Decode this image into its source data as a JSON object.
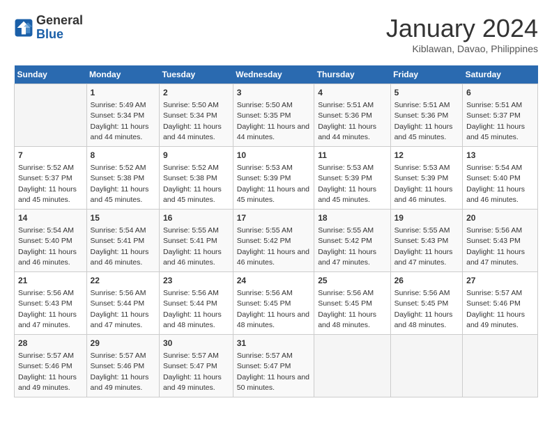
{
  "logo": {
    "text_general": "General",
    "text_blue": "Blue"
  },
  "header": {
    "title": "January 2024",
    "subtitle": "Kiblawan, Davao, Philippines"
  },
  "days_of_week": [
    "Sunday",
    "Monday",
    "Tuesday",
    "Wednesday",
    "Thursday",
    "Friday",
    "Saturday"
  ],
  "weeks": [
    [
      {
        "day": "",
        "sunrise": "",
        "sunset": "",
        "daylight": ""
      },
      {
        "day": "1",
        "sunrise": "Sunrise: 5:49 AM",
        "sunset": "Sunset: 5:34 PM",
        "daylight": "Daylight: 11 hours and 44 minutes."
      },
      {
        "day": "2",
        "sunrise": "Sunrise: 5:50 AM",
        "sunset": "Sunset: 5:34 PM",
        "daylight": "Daylight: 11 hours and 44 minutes."
      },
      {
        "day": "3",
        "sunrise": "Sunrise: 5:50 AM",
        "sunset": "Sunset: 5:35 PM",
        "daylight": "Daylight: 11 hours and 44 minutes."
      },
      {
        "day": "4",
        "sunrise": "Sunrise: 5:51 AM",
        "sunset": "Sunset: 5:36 PM",
        "daylight": "Daylight: 11 hours and 44 minutes."
      },
      {
        "day": "5",
        "sunrise": "Sunrise: 5:51 AM",
        "sunset": "Sunset: 5:36 PM",
        "daylight": "Daylight: 11 hours and 45 minutes."
      },
      {
        "day": "6",
        "sunrise": "Sunrise: 5:51 AM",
        "sunset": "Sunset: 5:37 PM",
        "daylight": "Daylight: 11 hours and 45 minutes."
      }
    ],
    [
      {
        "day": "7",
        "sunrise": "Sunrise: 5:52 AM",
        "sunset": "Sunset: 5:37 PM",
        "daylight": "Daylight: 11 hours and 45 minutes."
      },
      {
        "day": "8",
        "sunrise": "Sunrise: 5:52 AM",
        "sunset": "Sunset: 5:38 PM",
        "daylight": "Daylight: 11 hours and 45 minutes."
      },
      {
        "day": "9",
        "sunrise": "Sunrise: 5:52 AM",
        "sunset": "Sunset: 5:38 PM",
        "daylight": "Daylight: 11 hours and 45 minutes."
      },
      {
        "day": "10",
        "sunrise": "Sunrise: 5:53 AM",
        "sunset": "Sunset: 5:39 PM",
        "daylight": "Daylight: 11 hours and 45 minutes."
      },
      {
        "day": "11",
        "sunrise": "Sunrise: 5:53 AM",
        "sunset": "Sunset: 5:39 PM",
        "daylight": "Daylight: 11 hours and 45 minutes."
      },
      {
        "day": "12",
        "sunrise": "Sunrise: 5:53 AM",
        "sunset": "Sunset: 5:39 PM",
        "daylight": "Daylight: 11 hours and 46 minutes."
      },
      {
        "day": "13",
        "sunrise": "Sunrise: 5:54 AM",
        "sunset": "Sunset: 5:40 PM",
        "daylight": "Daylight: 11 hours and 46 minutes."
      }
    ],
    [
      {
        "day": "14",
        "sunrise": "Sunrise: 5:54 AM",
        "sunset": "Sunset: 5:40 PM",
        "daylight": "Daylight: 11 hours and 46 minutes."
      },
      {
        "day": "15",
        "sunrise": "Sunrise: 5:54 AM",
        "sunset": "Sunset: 5:41 PM",
        "daylight": "Daylight: 11 hours and 46 minutes."
      },
      {
        "day": "16",
        "sunrise": "Sunrise: 5:55 AM",
        "sunset": "Sunset: 5:41 PM",
        "daylight": "Daylight: 11 hours and 46 minutes."
      },
      {
        "day": "17",
        "sunrise": "Sunrise: 5:55 AM",
        "sunset": "Sunset: 5:42 PM",
        "daylight": "Daylight: 11 hours and 46 minutes."
      },
      {
        "day": "18",
        "sunrise": "Sunrise: 5:55 AM",
        "sunset": "Sunset: 5:42 PM",
        "daylight": "Daylight: 11 hours and 47 minutes."
      },
      {
        "day": "19",
        "sunrise": "Sunrise: 5:55 AM",
        "sunset": "Sunset: 5:43 PM",
        "daylight": "Daylight: 11 hours and 47 minutes."
      },
      {
        "day": "20",
        "sunrise": "Sunrise: 5:56 AM",
        "sunset": "Sunset: 5:43 PM",
        "daylight": "Daylight: 11 hours and 47 minutes."
      }
    ],
    [
      {
        "day": "21",
        "sunrise": "Sunrise: 5:56 AM",
        "sunset": "Sunset: 5:43 PM",
        "daylight": "Daylight: 11 hours and 47 minutes."
      },
      {
        "day": "22",
        "sunrise": "Sunrise: 5:56 AM",
        "sunset": "Sunset: 5:44 PM",
        "daylight": "Daylight: 11 hours and 47 minutes."
      },
      {
        "day": "23",
        "sunrise": "Sunrise: 5:56 AM",
        "sunset": "Sunset: 5:44 PM",
        "daylight": "Daylight: 11 hours and 48 minutes."
      },
      {
        "day": "24",
        "sunrise": "Sunrise: 5:56 AM",
        "sunset": "Sunset: 5:45 PM",
        "daylight": "Daylight: 11 hours and 48 minutes."
      },
      {
        "day": "25",
        "sunrise": "Sunrise: 5:56 AM",
        "sunset": "Sunset: 5:45 PM",
        "daylight": "Daylight: 11 hours and 48 minutes."
      },
      {
        "day": "26",
        "sunrise": "Sunrise: 5:56 AM",
        "sunset": "Sunset: 5:45 PM",
        "daylight": "Daylight: 11 hours and 48 minutes."
      },
      {
        "day": "27",
        "sunrise": "Sunrise: 5:57 AM",
        "sunset": "Sunset: 5:46 PM",
        "daylight": "Daylight: 11 hours and 49 minutes."
      }
    ],
    [
      {
        "day": "28",
        "sunrise": "Sunrise: 5:57 AM",
        "sunset": "Sunset: 5:46 PM",
        "daylight": "Daylight: 11 hours and 49 minutes."
      },
      {
        "day": "29",
        "sunrise": "Sunrise: 5:57 AM",
        "sunset": "Sunset: 5:46 PM",
        "daylight": "Daylight: 11 hours and 49 minutes."
      },
      {
        "day": "30",
        "sunrise": "Sunrise: 5:57 AM",
        "sunset": "Sunset: 5:47 PM",
        "daylight": "Daylight: 11 hours and 49 minutes."
      },
      {
        "day": "31",
        "sunrise": "Sunrise: 5:57 AM",
        "sunset": "Sunset: 5:47 PM",
        "daylight": "Daylight: 11 hours and 50 minutes."
      },
      {
        "day": "",
        "sunrise": "",
        "sunset": "",
        "daylight": ""
      },
      {
        "day": "",
        "sunrise": "",
        "sunset": "",
        "daylight": ""
      },
      {
        "day": "",
        "sunrise": "",
        "sunset": "",
        "daylight": ""
      }
    ]
  ]
}
